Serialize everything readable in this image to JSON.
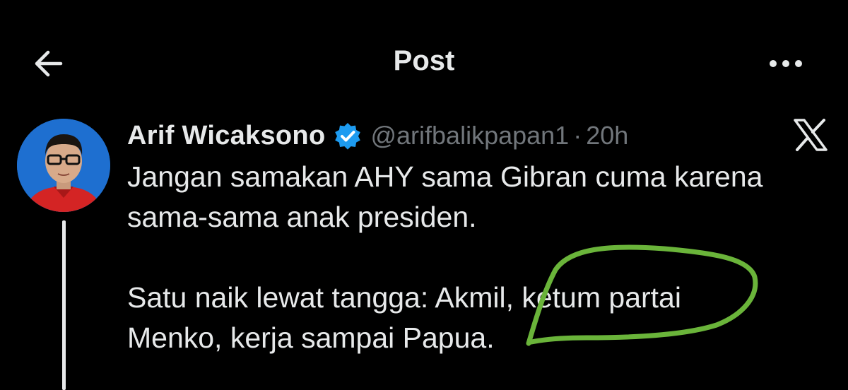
{
  "header": {
    "title": "Post",
    "back_icon": "arrow-left-icon",
    "more_icon": "more-horizontal-icon"
  },
  "tweet": {
    "author_name": "Arif Wicaksono",
    "verified": true,
    "handle": "@arifbalikpapan1",
    "separator": "·",
    "time": "20h",
    "source_icon": "x-logo-icon",
    "paragraphs": [
      "Jangan samakan AHY sama Gibran cuma karena\nsama-sama anak presiden.",
      "Satu naik lewat tangga: Akmil, ketum partai\nMenko, kerja sampai Papua."
    ]
  },
  "colors": {
    "background": "#000000",
    "text": "#e7e9ea",
    "muted": "#71767b",
    "verified_badge": "#1d9bf0",
    "annotation_stroke": "#6ab43a"
  }
}
